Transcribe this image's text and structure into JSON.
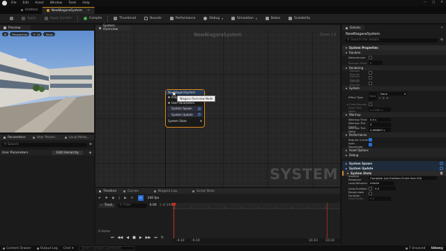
{
  "menu": [
    "File",
    "Edit",
    "Asset",
    "Window",
    "Tools",
    "Help"
  ],
  "doc_tabs": [
    {
      "label": "Untitled",
      "active": false
    },
    {
      "label": "NewNiagaraSystem",
      "active": true
    }
  ],
  "toolbar": {
    "buttons": [
      "Apply",
      "Apply Scratch",
      "Compile",
      "Thumbnail",
      "Bounds",
      "Performance",
      "Debug",
      "Simulation",
      "Bakes",
      "Scalability"
    ]
  },
  "preview": {
    "tab": "Preview",
    "perspective": "Perspective",
    "lit": "Lit",
    "show": "Show"
  },
  "params": {
    "tabs": [
      "Parameters",
      "User Param...",
      "Local Modu..."
    ],
    "search_placeholder": "Search",
    "user_params": "User Parameters",
    "edit_hierarchy": "Edit Hierarchy"
  },
  "overview": {
    "tab": "System Overview",
    "graph_title": "NewNiagaraSystem",
    "zoom": "Zoom 1:1",
    "watermark": "SYSTEM",
    "tooltip": "Niagara Overview Node",
    "node": {
      "title": "NewNiagaraSystem",
      "rows": [
        "Properties",
        "User Parameters",
        "System Spawn",
        "System Update",
        "System State"
      ]
    }
  },
  "timeline": {
    "tabs": [
      "Timeline",
      "Curves",
      "Niagara Log",
      "Script Stats"
    ],
    "fps": "240 fps",
    "track": "Track",
    "filter_placeholder": "Filter",
    "time": "0.00",
    "frames": "1 of 2400",
    "items": "0 items",
    "start": "0.00",
    "end_a": "-0.10",
    "end_b": "-0.10",
    "end_c": "10.10",
    "end_d": "10.10",
    "ticks": [
      "0.00",
      "2.00",
      "4.00",
      "6.00",
      "8.00",
      "10.00"
    ]
  },
  "details": {
    "tab": "Details",
    "title": "NewNiagaraSystem",
    "search_placeholder": "Search the details",
    "sections": [
      {
        "name": "System Properties",
        "kind": "header"
      },
      {
        "name": "Random",
        "kind": "sub"
      },
      {
        "kind": "prop",
        "label": "Determinism",
        "type": "check",
        "value": false
      },
      {
        "kind": "prop",
        "label": "Random Seed",
        "type": "text",
        "value": "0"
      },
      {
        "name": "Rendering",
        "kind": "sub"
      },
      {
        "kind": "prop",
        "label": "Default Bounds",
        "type": "check",
        "value": false
      },
      {
        "kind": "prop",
        "label": "Default Bounds",
        "type": "check",
        "value": false
      },
      {
        "kind": "prop",
        "label": "Default Bounds",
        "type": "check",
        "value": false
      },
      {
        "name": "System",
        "kind": "sub"
      },
      {
        "kind": "prop",
        "label": "Effect Type",
        "type": "asset",
        "value": "None"
      },
      {
        "kind": "prop",
        "label": "Fixed Bounds",
        "type": "check",
        "value": false
      },
      {
        "kind": "prop",
        "label": "Fixed Tick Delta",
        "type": "text",
        "value": "0.01667 s"
      },
      {
        "name": "Warmup",
        "kind": "sub"
      },
      {
        "kind": "prop",
        "label": "Warmup Time",
        "type": "text",
        "value": "0.0 s"
      },
      {
        "kind": "prop",
        "label": "Warmup Tick Count",
        "type": "text",
        "value": "0"
      },
      {
        "kind": "prop",
        "label": "Warmup Tick Delta",
        "type": "text",
        "value": "0.066667 s"
      },
      {
        "name": "Performance",
        "kind": "sub"
      },
      {
        "kind": "prop",
        "label": "Require Current Frame Data",
        "type": "check",
        "value": true
      },
      {
        "kind": "prop",
        "label": "Auto Deactivate",
        "type": "check",
        "value": true
      },
      {
        "name": "Asset Options",
        "kind": "sub"
      },
      {
        "name": "Debug",
        "kind": "sub"
      }
    ],
    "modules": [
      "System Spawn",
      "System Update",
      "System State"
    ],
    "state": [
      {
        "label": "Inactive Response",
        "value": "Complete (Let Emitters Finish then Kill)"
      },
      {
        "label": "Loop Behavior",
        "value": "Infinite"
      },
      {
        "label": "Loop Duration",
        "value": "5.0"
      },
      {
        "label": "Recalculate Duration",
        "value": ""
      },
      {
        "label": "Loop Delay",
        "value": "0.0"
      }
    ]
  },
  "statusbar": {
    "content_drawer": "Content Drawer",
    "output_log": "Output Log",
    "cmd": "Cmd",
    "console_placeholder": "Enter Console Command",
    "unsaved": "7 Unsaved",
    "source_control": "Udemy"
  }
}
